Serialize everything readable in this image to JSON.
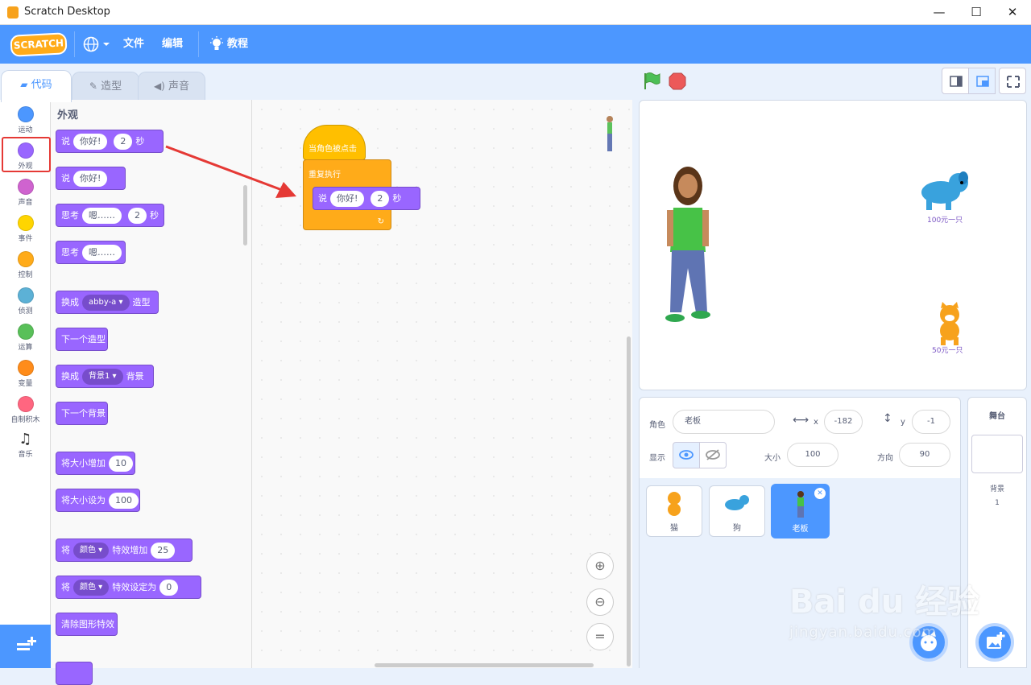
{
  "window": {
    "title": "Scratch Desktop",
    "minimize": "—",
    "maximize": "☐",
    "close": "✕"
  },
  "menu": {
    "logo": "SCRATCH",
    "file": "文件",
    "edit": "编辑",
    "tutorials": "教程"
  },
  "tabs": [
    {
      "label": "代码"
    },
    {
      "label": "造型"
    },
    {
      "label": "声音"
    }
  ],
  "categories": [
    {
      "label": "运动",
      "color": "#4c97ff"
    },
    {
      "label": "外观",
      "color": "#9966ff"
    },
    {
      "label": "声音",
      "color": "#cf63cf"
    },
    {
      "label": "事件",
      "color": "#ffd500"
    },
    {
      "label": "控制",
      "color": "#ffab19"
    },
    {
      "label": "侦测",
      "color": "#5cb1d6"
    },
    {
      "label": "运算",
      "color": "#59c059"
    },
    {
      "label": "变量",
      "color": "#ff8c1a"
    },
    {
      "label": "自制积木",
      "color": "#ff6680"
    },
    {
      "label": "音乐",
      "color": ""
    }
  ],
  "palette": {
    "heading": "外观",
    "say_secs": {
      "verb": "说",
      "text": "你好!",
      "secs": "2",
      "unit": "秒"
    },
    "say": {
      "verb": "说",
      "text": "你好!"
    },
    "think_secs": {
      "verb": "思考",
      "text": "嗯……",
      "secs": "2",
      "unit": "秒"
    },
    "think": {
      "verb": "思考",
      "text": "嗯……"
    },
    "switch_costume": {
      "verb": "换成",
      "value": "abby-a ▾",
      "suffix": "造型"
    },
    "next_costume": {
      "label": "下一个造型"
    },
    "switch_backdrop": {
      "verb": "换成",
      "value": "背景1 ▾",
      "suffix": "背景"
    },
    "next_backdrop": {
      "label": "下一个背景"
    },
    "change_size": {
      "label": "将大小增加",
      "value": "10"
    },
    "set_size": {
      "label": "将大小设为",
      "value": "100"
    },
    "change_effect": {
      "verb": "将",
      "effect": "颜色 ▾",
      "mid": "特效增加",
      "value": "25"
    },
    "set_effect": {
      "verb": "将",
      "effect": "颜色 ▾",
      "mid": "特效设定为",
      "value": "0"
    },
    "clear_effects": {
      "label": "清除图形特效"
    }
  },
  "script": {
    "hat": "当角色被点击",
    "forever": "重复执行",
    "say_verb": "说",
    "say_text": "你好!",
    "say_secs": "2",
    "say_unit": "秒"
  },
  "zoom": {
    "in": "⊕",
    "out": "⊖",
    "reset": "="
  },
  "stage": {
    "dog_label": "100元一只",
    "cat_label": "50元一只"
  },
  "sprite_info": {
    "sprite_label": "角色",
    "sprite_name": "老板",
    "x_label": "x",
    "x_value": "-182",
    "y_label": "y",
    "y_value": "-1",
    "show_label": "显示",
    "size_label": "大小",
    "size_value": "100",
    "direction_label": "方向",
    "direction_value": "90"
  },
  "sprites": [
    {
      "name": "猫"
    },
    {
      "name": "狗"
    },
    {
      "name": "老板"
    }
  ],
  "stage_panel": {
    "title": "舞台",
    "backdrops_label": "背景",
    "backdrops_count": "1"
  },
  "watermark": {
    "brand": "Bai du 经验",
    "url": "jingyan.baidu.com"
  }
}
